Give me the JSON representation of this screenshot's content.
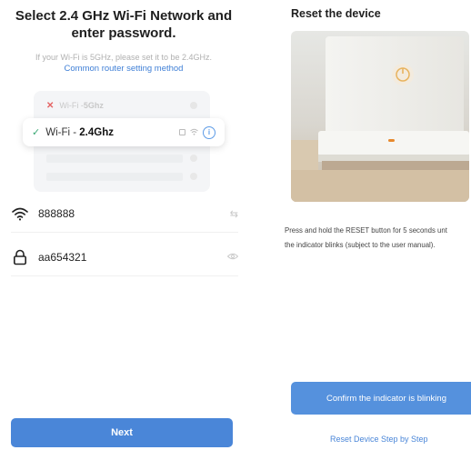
{
  "wifi_screen": {
    "title": "Select 2.4 GHz Wi-Fi Network and enter password.",
    "hint": "If your Wi-Fi is 5GHz, please set it to be 2.4GHz.",
    "help_link": "Common router setting method",
    "networks": {
      "unsupported_prefix": "Wi-Fi - ",
      "unsupported_band": "5Ghz",
      "selected_prefix": "Wi-Fi - ",
      "selected_band": "2.4Ghz"
    },
    "ssid_value": "888888",
    "password_value": "aa654321",
    "next_label": "Next",
    "accent_color": "#4a86d8"
  },
  "reset_screen": {
    "title": "Reset the device",
    "instruction_line1": "Press and hold the RESET button for 5 seconds unt",
    "instruction_line2": "the indicator blinks (subject to the user manual).",
    "confirm_label": "Confirm the indicator is blinking",
    "step_link": "Reset Device Step by Step",
    "accent_color": "#5591dd"
  },
  "icons": {
    "wifi": "wifi-icon",
    "lock": "lock-icon",
    "switch": "swap-icon",
    "eye": "eye-icon",
    "info": "info-icon",
    "check": "checkmark-icon",
    "close": "close-icon"
  }
}
